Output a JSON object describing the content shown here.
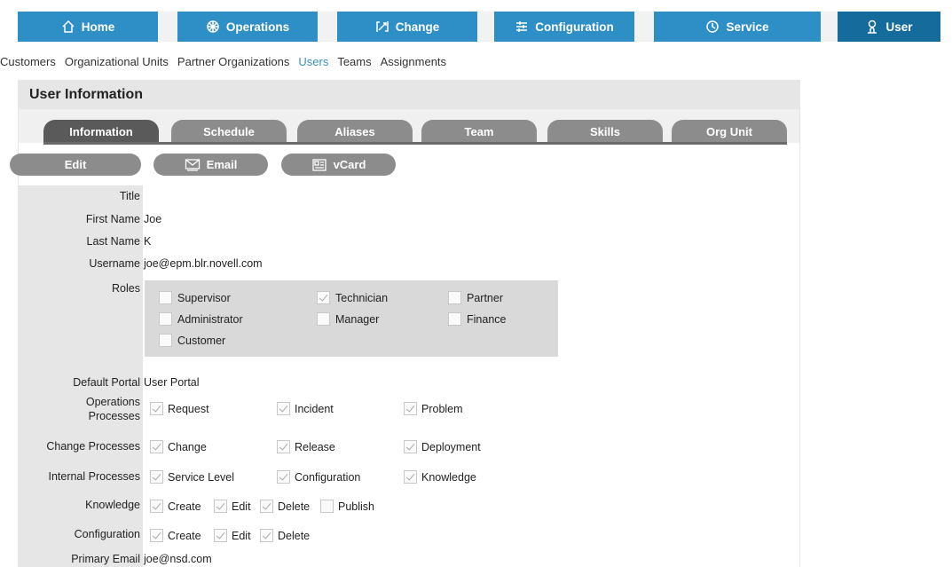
{
  "topnav": {
    "tabs": [
      {
        "label": "Home",
        "icon": "home-icon"
      },
      {
        "label": "Operations",
        "icon": "operations-icon"
      },
      {
        "label": "Change",
        "icon": "change-icon"
      },
      {
        "label": "Configuration",
        "icon": "configuration-icon"
      },
      {
        "label": "Service",
        "icon": "clock-icon"
      },
      {
        "label": "User",
        "icon": "user-icon",
        "active": true
      }
    ]
  },
  "subnav": {
    "items": [
      {
        "label": "Customers"
      },
      {
        "label": "Organizational Units"
      },
      {
        "label": "Partner Organizations"
      },
      {
        "label": "Users",
        "active": true
      },
      {
        "label": "Teams"
      },
      {
        "label": "Assignments"
      }
    ]
  },
  "panel": {
    "title": "User Information",
    "tabs": [
      {
        "label": "Information",
        "active": true
      },
      {
        "label": "Schedule"
      },
      {
        "label": "Aliases"
      },
      {
        "label": "Team"
      },
      {
        "label": "Skills"
      },
      {
        "label": "Org Unit"
      }
    ],
    "actions": {
      "edit": "Edit",
      "email": "Email",
      "vcard": "vCard"
    }
  },
  "form": {
    "title_label": "Title",
    "title_value": "",
    "first_name_label": "First Name",
    "first_name_value": "Joe",
    "last_name_label": "Last Name",
    "last_name_value": "K",
    "username_label": "Username",
    "username_value": "joe@epm.blr.novell.com",
    "roles_label": "Roles",
    "roles": [
      {
        "label": "Supervisor",
        "checked": false
      },
      {
        "label": "Technician",
        "checked": true
      },
      {
        "label": "Partner",
        "checked": false
      },
      {
        "label": "Administrator",
        "checked": false
      },
      {
        "label": "Manager",
        "checked": false
      },
      {
        "label": "Finance",
        "checked": false
      },
      {
        "label": "Customer",
        "checked": false
      }
    ],
    "default_portal_label": "Default Portal",
    "default_portal_value": "User Portal",
    "operations_label_1": "Operations",
    "operations_label_2": "Processes",
    "operations": [
      {
        "label": "Request",
        "checked": true
      },
      {
        "label": "Incident",
        "checked": true
      },
      {
        "label": "Problem",
        "checked": true
      }
    ],
    "change_label": "Change Processes",
    "change": [
      {
        "label": "Change",
        "checked": true
      },
      {
        "label": "Release",
        "checked": true
      },
      {
        "label": "Deployment",
        "checked": true
      }
    ],
    "internal_label": "Internal Processes",
    "internal": [
      {
        "label": "Service Level",
        "checked": true
      },
      {
        "label": "Configuration",
        "checked": true
      },
      {
        "label": "Knowledge",
        "checked": true
      }
    ],
    "knowledge_label": "Knowledge",
    "knowledge": [
      {
        "label": "Create",
        "checked": true
      },
      {
        "label": "Edit",
        "checked": true
      },
      {
        "label": "Delete",
        "checked": true
      },
      {
        "label": "Publish",
        "checked": false
      }
    ],
    "configuration_label": "Configuration",
    "configuration": [
      {
        "label": "Create",
        "checked": true
      },
      {
        "label": "Edit",
        "checked": true
      },
      {
        "label": "Delete",
        "checked": true
      }
    ],
    "primary_email_label": "Primary Email",
    "primary_email_value": "joe@nsd.com"
  }
}
